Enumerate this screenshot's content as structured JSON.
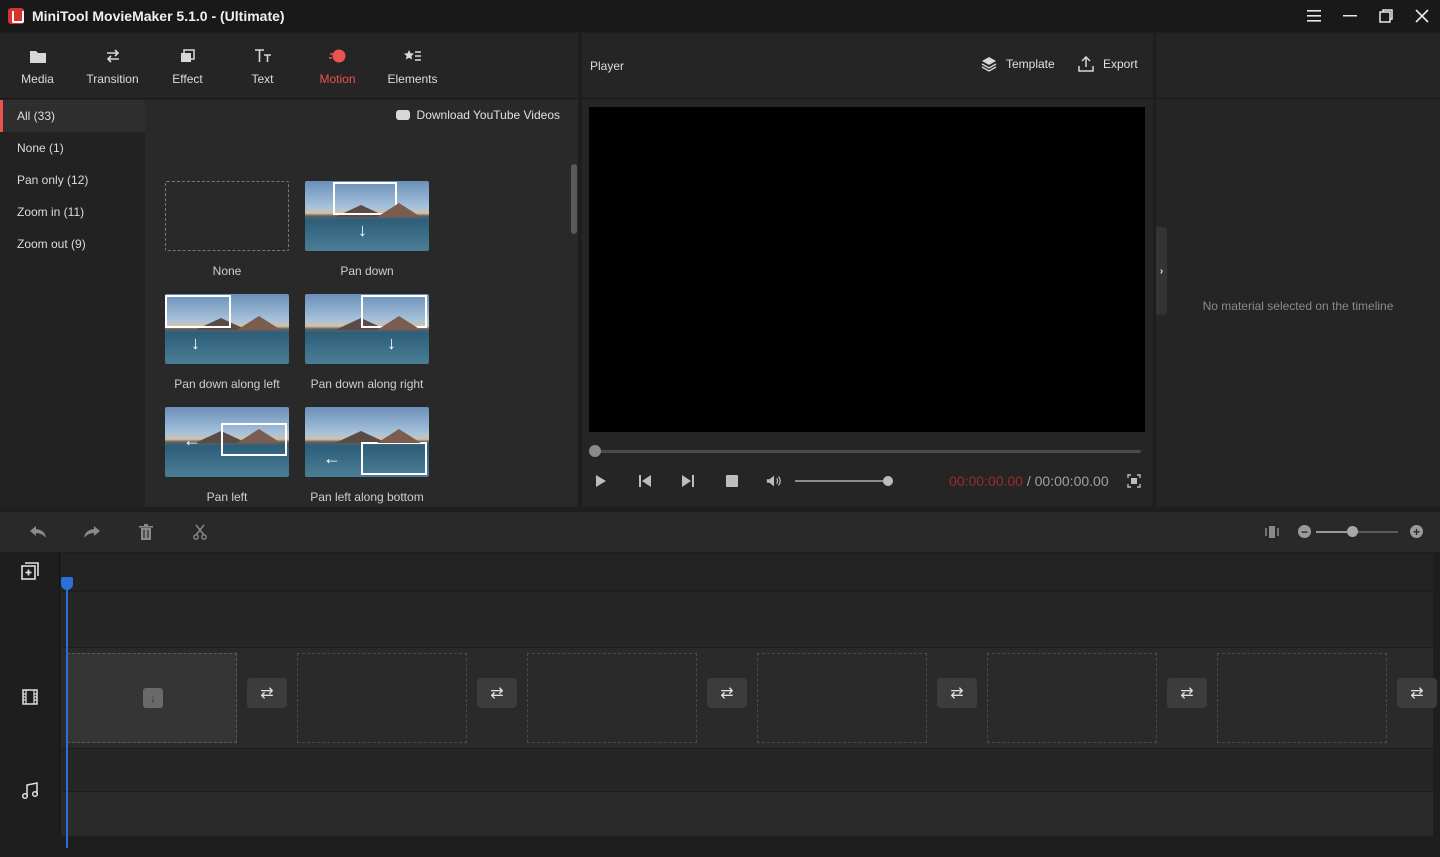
{
  "window": {
    "title": "MiniTool MovieMaker 5.1.0 - (Ultimate)",
    "controls": [
      "menu-icon",
      "minimize-icon",
      "maximize-icon",
      "close-icon"
    ]
  },
  "toolbar": {
    "tabs": [
      {
        "label": "Media",
        "icon": "folder-icon"
      },
      {
        "label": "Transition",
        "icon": "transition-arrows-icon"
      },
      {
        "label": "Effect",
        "icon": "effect-layers-icon"
      },
      {
        "label": "Text",
        "icon": "text-tt-icon"
      },
      {
        "label": "Motion",
        "icon": "motion-icon",
        "active": true
      },
      {
        "label": "Elements",
        "icon": "elements-icon"
      }
    ],
    "accent_color": "#ea5350"
  },
  "categories": [
    {
      "label": "All (33)",
      "active": true
    },
    {
      "label": "None (1)"
    },
    {
      "label": "Pan only (12)"
    },
    {
      "label": "Zoom in (11)"
    },
    {
      "label": "Zoom out (9)"
    }
  ],
  "content": {
    "download_label": "Download YouTube Videos",
    "items": [
      {
        "label": "None"
      },
      {
        "label": "Pan down"
      },
      {
        "label": "Pan down along left"
      },
      {
        "label": "Pan down along right"
      },
      {
        "label": "Pan left"
      },
      {
        "label": "Pan left along bottom"
      }
    ]
  },
  "player": {
    "title": "Player",
    "template_label": "Template",
    "export_label": "Export",
    "current_time": "00:00:00.00",
    "separator": " / ",
    "total_time": "00:00:00.00"
  },
  "properties": {
    "empty_message": "No material selected on the timeline"
  },
  "timeline": {
    "tools": [
      "undo-icon",
      "redo-icon",
      "delete-icon",
      "scissors-icon"
    ],
    "playhead_color": "#2b6fd8",
    "tracks": [
      "overlay-track",
      "video-track",
      "audio-track"
    ]
  }
}
